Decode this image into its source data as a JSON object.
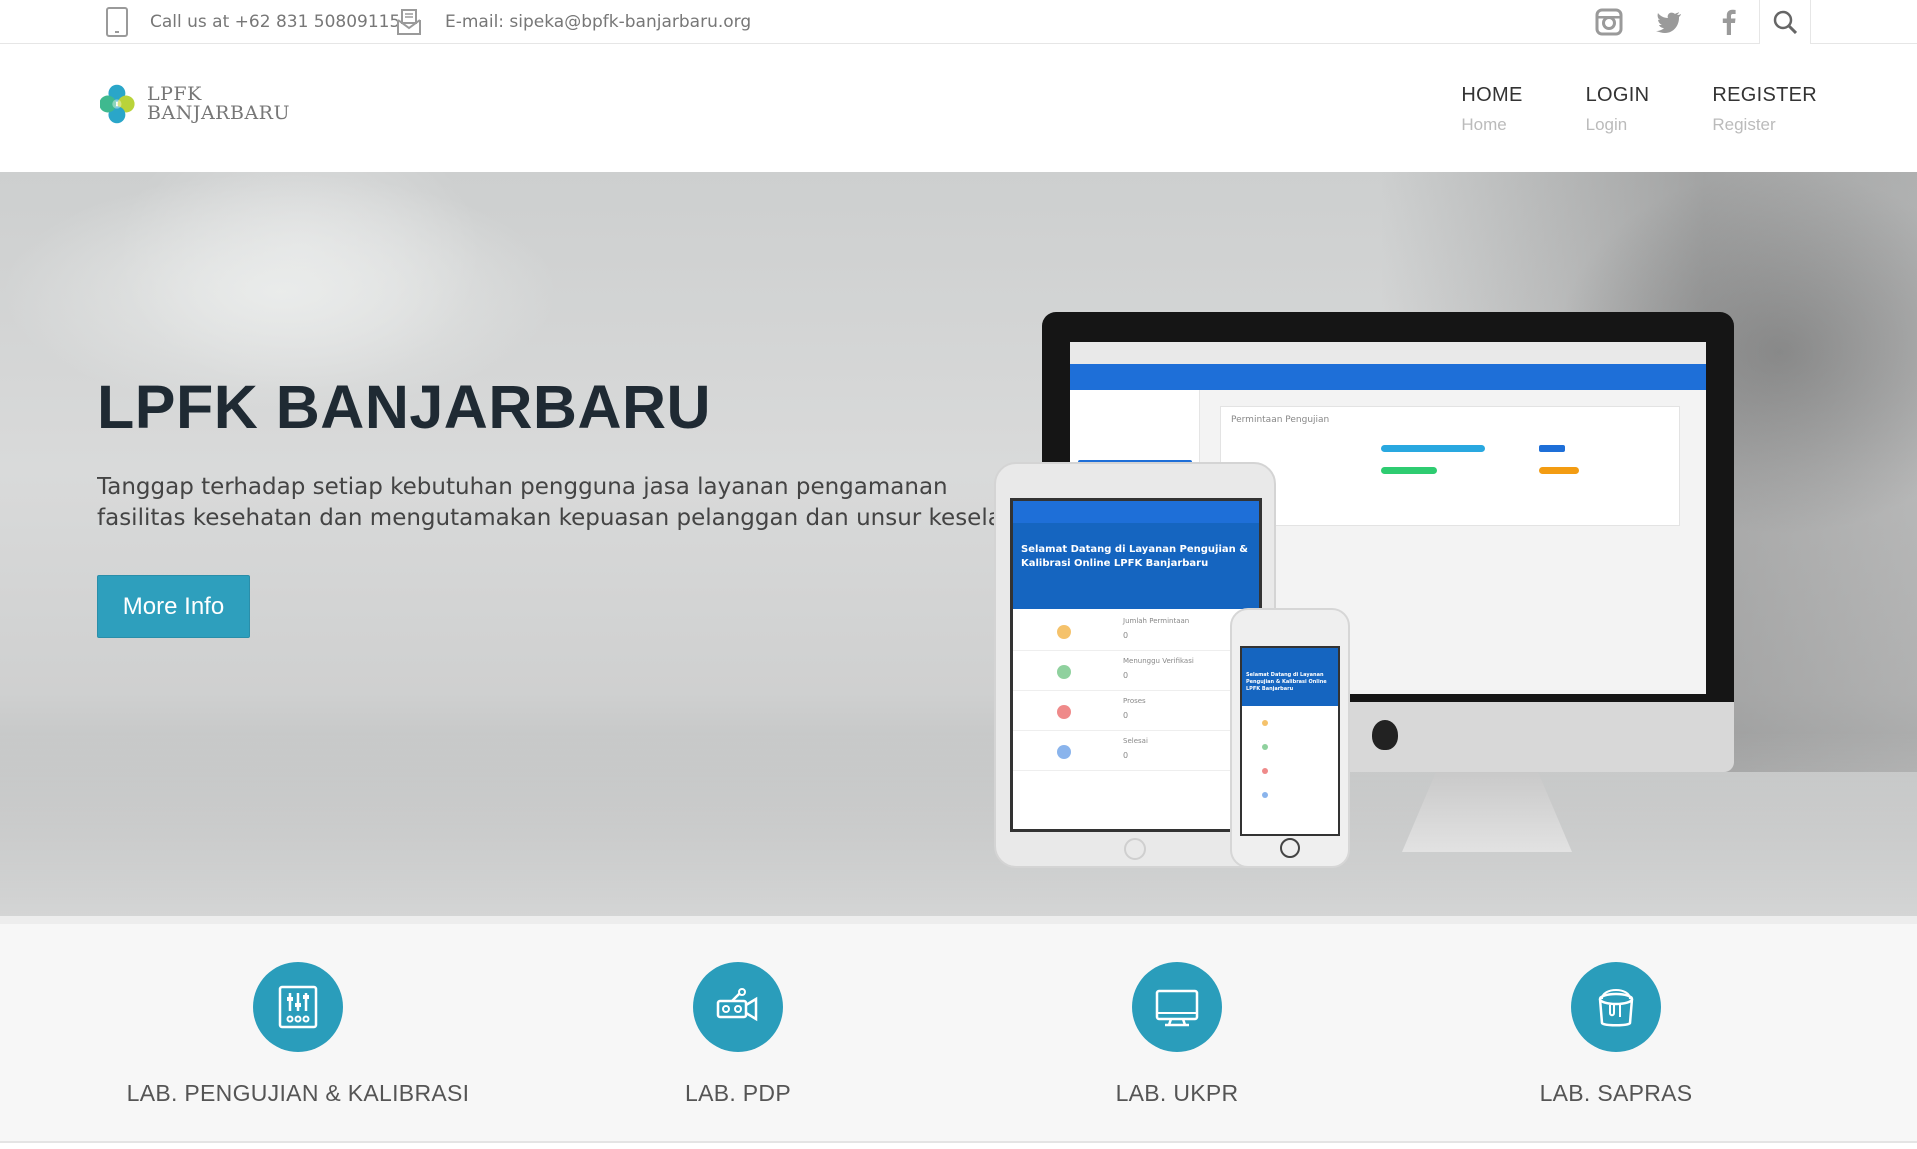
{
  "topbar": {
    "phone": "Call us at +62 831 50809115",
    "email": "E-mail: sipeka@bpfk-banjarbaru.org"
  },
  "header": {
    "logo_line1": "LPFK",
    "logo_line2": "BANJARBARU",
    "nav": [
      {
        "label": "HOME",
        "sub": "Home"
      },
      {
        "label": "LOGIN",
        "sub": "Login"
      },
      {
        "label": "REGISTER",
        "sub": "Register"
      }
    ]
  },
  "hero": {
    "title": "LPFK BANJARBARU",
    "desc_line1": "Tanggap terhadap setiap kebutuhan pengguna jasa layanan pengamanan",
    "desc_line2": "fasilitas kesehatan dan mengutamakan kepuasan pelanggan dan unsur keselamatan",
    "button": "More Info"
  },
  "mockup": {
    "desktop_heading": "Permintaan Pengujian",
    "tablet_welcome": "Selamat Datang di Layanan Pengujian & Kalibrasi Online LPFK Banjarbaru",
    "tablet_rows": [
      {
        "label": "Jumlah Permintaan",
        "value": "0"
      },
      {
        "label": "Menunggu Verifikasi",
        "value": "0"
      },
      {
        "label": "Proses",
        "value": "0"
      },
      {
        "label": "Selesai",
        "value": "0"
      }
    ]
  },
  "features": [
    {
      "label": "LAB. PENGUJIAN & KALIBRASI",
      "icon": "sliders-icon"
    },
    {
      "label": "LAB. PDP",
      "icon": "truck-icon"
    },
    {
      "label": "LAB. UKPR",
      "icon": "monitor-icon"
    },
    {
      "label": "LAB. SAPRAS",
      "icon": "paint-bucket-icon"
    }
  ],
  "colors": {
    "accent": "#2a9dbb",
    "app_blue": "#1e6fd8"
  }
}
